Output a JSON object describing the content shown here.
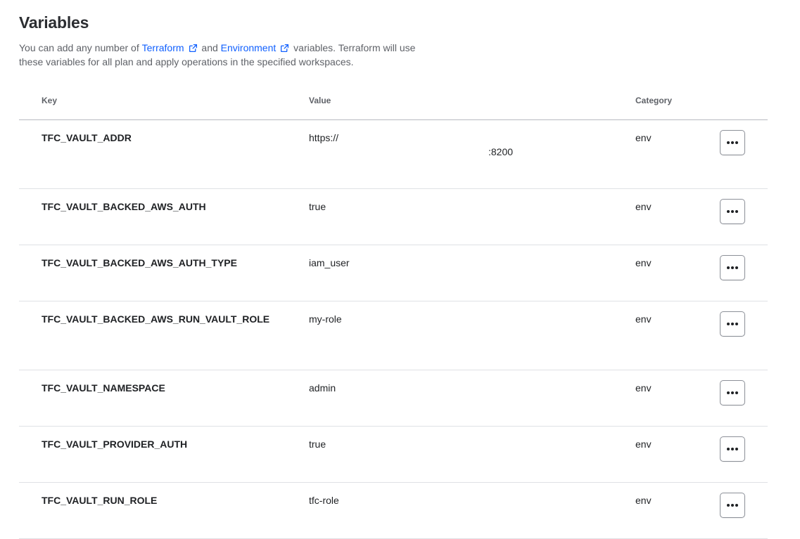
{
  "header": {
    "title": "Variables",
    "desc_prefix": "You can add any number of",
    "terraform_link": "Terraform",
    "desc_and": "and",
    "environment_link": "Environment",
    "desc_suffix": "variables. Terraform will use these variables for all plan and apply operations in the specified workspaces."
  },
  "table": {
    "columns": {
      "key": "Key",
      "value": "Value",
      "category": "Category"
    },
    "rows": [
      {
        "key": "TFC_VAULT_ADDR",
        "value": "https://",
        "value_line2": ":8200",
        "category": "env"
      },
      {
        "key": "TFC_VAULT_BACKED_AWS_AUTH",
        "value": "true",
        "category": "env"
      },
      {
        "key": "TFC_VAULT_BACKED_AWS_AUTH_TYPE",
        "value": "iam_user",
        "category": "env"
      },
      {
        "key": "TFC_VAULT_BACKED_AWS_RUN_VAULT_ROLE",
        "value": "my-role",
        "category": "env"
      },
      {
        "key": "TFC_VAULT_NAMESPACE",
        "value": "admin",
        "category": "env"
      },
      {
        "key": "TFC_VAULT_PROVIDER_AUTH",
        "value": "true",
        "category": "env"
      },
      {
        "key": "TFC_VAULT_RUN_ROLE",
        "value": "tfc-role",
        "category": "env"
      }
    ],
    "row_action_icon": "more-horizontal-icon"
  },
  "colors": {
    "link": "#1060ff",
    "text": "#1f2124",
    "muted": "#5f6268"
  }
}
